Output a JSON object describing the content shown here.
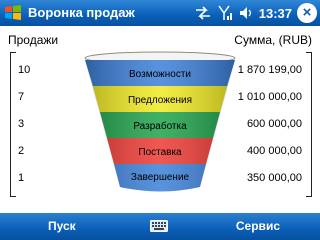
{
  "titlebar": {
    "title": "Воронка продаж",
    "clock": "13:37"
  },
  "headers": {
    "left": "Продажи",
    "right": "Сумма, (RUB)"
  },
  "stages": [
    {
      "label": "Возможности",
      "count": "10",
      "sum": "1 870 199,00",
      "color": "#3b7fd8"
    },
    {
      "label": "Предложения",
      "count": "7",
      "sum": "1 010 000,00",
      "color": "#f0ea22"
    },
    {
      "label": "Разработка",
      "count": "3",
      "sum": "600 000,00",
      "color": "#1fa34a"
    },
    {
      "label": "Поставка",
      "count": "2",
      "sum": "400 000,00",
      "color": "#ee3a33"
    },
    {
      "label": "Завершение",
      "count": "1",
      "sum": "350 000,00",
      "color": "#3b7fd8"
    }
  ],
  "menubar": {
    "left": "Пуск",
    "right": "Сервис"
  },
  "icons": {
    "logo": "windows-logo-icon",
    "sync": "sync-arrows-icon",
    "signal": "signal-icon",
    "volume": "volume-icon",
    "keyboard": "keyboard-icon"
  }
}
